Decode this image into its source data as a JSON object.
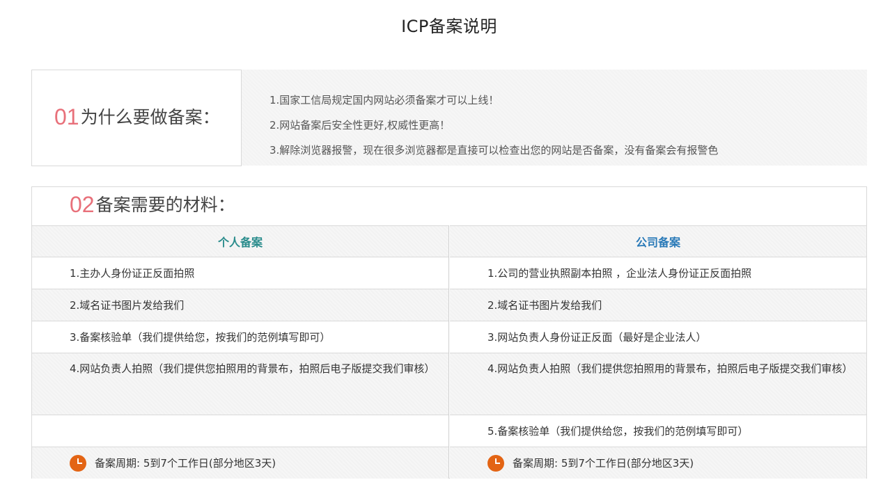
{
  "page_title": "ICP备案说明",
  "why": {
    "number": "01",
    "heading": "为什么要做备案：",
    "items": [
      "1.国家工信局规定国内网站必须备案才可以上线！",
      "2.网站备案后安全性更好,权威性更高！",
      "3.解除浏览器报警，现在很多浏览器都是直接可以检查出您的网站是否备案，没有备案会有报警色"
    ]
  },
  "materials": {
    "number": "02",
    "heading": "备案需要的材料：",
    "personal": {
      "title": "个人备案",
      "items": [
        "1.主办人身份证正反面拍照",
        "2.域名证书图片发给我们",
        "3.备案核验单（我们提供给您，按我们的范例填写即可）",
        "4.网站负责人拍照（我们提供您拍照用的背景布，拍照后电子版提交我们审核）"
      ],
      "period": "备案周期: 5到7个工作日(部分地区3天)"
    },
    "company": {
      "title": "公司备案",
      "items": [
        "1.公司的营业执照副本拍照 ，企业法人身份证正反面拍照",
        "2.域名证书图片发给我们",
        "3.网站负责人身份证正反面（最好是企业法人）",
        "4.网站负责人拍照（我们提供您拍照用的背景布，拍照后电子版提交我们审核）",
        "5.备案核验单（我们提供给您，按我们的范例填写即可）"
      ],
      "period": "备案周期: 5到7个工作日(部分地区3天)"
    }
  },
  "icons": {
    "period_icon": "clock-icon",
    "accent": "#e36414",
    "number_color": "#e8707a"
  }
}
